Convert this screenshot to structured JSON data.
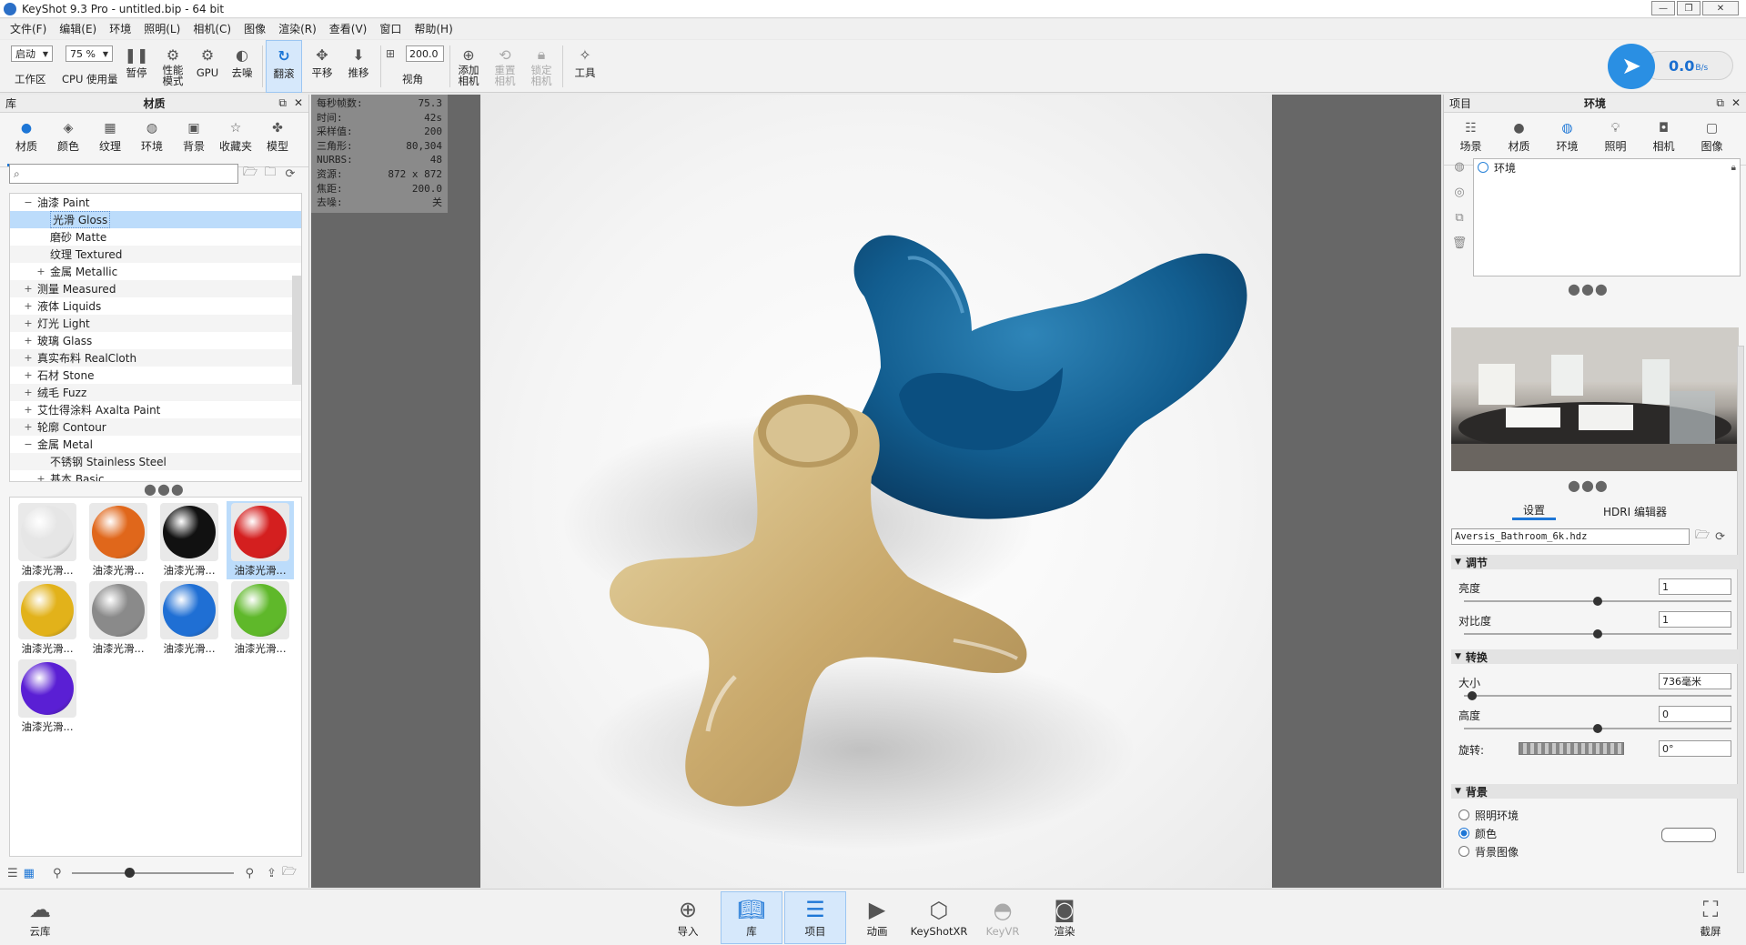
{
  "window": {
    "title": "KeyShot 9.3 Pro  - untitled.bip  - 64 bit",
    "min": "—",
    "max": "❐",
    "close": "✕"
  },
  "menu": [
    "文件(F)",
    "编辑(E)",
    "环境",
    "照明(L)",
    "相机(C)",
    "图像",
    "渲染(R)",
    "查看(V)",
    "窗口",
    "帮助(H)"
  ],
  "toolbar": {
    "workspace_select": "启动",
    "workspace_label": "工作区",
    "cpu_select": "75 %",
    "cpu_label": "CPU 使用量",
    "pause": "暂停",
    "perf_mode": "性能\n模式",
    "gpu": "GPU",
    "denoise": "去噪",
    "tumble": "翻滚",
    "pan": "平移",
    "dolly": "推移",
    "fov_value": "200.0",
    "fov_label": "视角",
    "add_camera": "添加\n相机",
    "reset_camera": "重置\n相机",
    "lock_camera": "锁定\n相机",
    "tools": "工具"
  },
  "throughput": {
    "value": "0.0",
    "unit": "B/s"
  },
  "library": {
    "left_title": "库",
    "title": "材质",
    "tabs": [
      {
        "label": "材质",
        "icon": "material-icon"
      },
      {
        "label": "颜色",
        "icon": "color-icon"
      },
      {
        "label": "纹理",
        "icon": "texture-icon"
      },
      {
        "label": "环境",
        "icon": "environment-icon"
      },
      {
        "label": "背景",
        "icon": "background-icon"
      },
      {
        "label": "收藏夹",
        "icon": "favorites-icon"
      },
      {
        "label": "模型",
        "icon": "model-icon"
      }
    ],
    "tree": [
      {
        "indent": 1,
        "toggle": "−",
        "label": "油漆 Paint"
      },
      {
        "indent": 2,
        "toggle": "",
        "label": "光滑 Gloss",
        "selected": true
      },
      {
        "indent": 2,
        "toggle": "",
        "label": "磨砂 Matte"
      },
      {
        "indent": 2,
        "toggle": "",
        "label": "纹理 Textured"
      },
      {
        "indent": 2,
        "toggle": "+",
        "label": "金属 Metallic"
      },
      {
        "indent": 1,
        "toggle": "+",
        "label": "测量 Measured"
      },
      {
        "indent": 1,
        "toggle": "+",
        "label": "液体 Liquids"
      },
      {
        "indent": 1,
        "toggle": "+",
        "label": "灯光 Light"
      },
      {
        "indent": 1,
        "toggle": "+",
        "label": "玻璃 Glass"
      },
      {
        "indent": 1,
        "toggle": "+",
        "label": "真实布料 RealCloth"
      },
      {
        "indent": 1,
        "toggle": "+",
        "label": "石材 Stone"
      },
      {
        "indent": 1,
        "toggle": "+",
        "label": "绒毛 Fuzz"
      },
      {
        "indent": 1,
        "toggle": "+",
        "label": "艾仕得涂料 Axalta Paint"
      },
      {
        "indent": 1,
        "toggle": "+",
        "label": "轮廓 Contour"
      },
      {
        "indent": 1,
        "toggle": "−",
        "label": "金属 Metal"
      },
      {
        "indent": 2,
        "toggle": "",
        "label": "不锈钢 Stainless Steel"
      },
      {
        "indent": 2,
        "toggle": "+",
        "label": "基本 Basic"
      }
    ],
    "materials": [
      {
        "label": "油漆光滑...",
        "color": "#e6e6e6"
      },
      {
        "label": "油漆光滑...",
        "color": "#e0671b"
      },
      {
        "label": "油漆光滑...",
        "color": "#111111"
      },
      {
        "label": "油漆光滑...",
        "color": "#d41f1f",
        "selected": true
      },
      {
        "label": "油漆光滑...",
        "color": "#e2b21a"
      },
      {
        "label": "油漆光滑...",
        "color": "#8a8a8a"
      },
      {
        "label": "油漆光滑...",
        "color": "#1f6fd4"
      },
      {
        "label": "油漆光滑...",
        "color": "#5fb82a"
      },
      {
        "label": "油漆光滑...",
        "color": "#5a1fd4"
      }
    ]
  },
  "hud": [
    {
      "k": "每秒帧数:",
      "v": "75.3"
    },
    {
      "k": "时间:",
      "v": "42s"
    },
    {
      "k": "采样值:",
      "v": "200"
    },
    {
      "k": "三角形:",
      "v": "80,304"
    },
    {
      "k": "NURBS:",
      "v": "48"
    },
    {
      "k": "资源:",
      "v": "872 x 872"
    },
    {
      "k": "焦距:",
      "v": "200.0"
    },
    {
      "k": "去噪:",
      "v": "关"
    }
  ],
  "project": {
    "left_title": "项目",
    "title": "环境",
    "tabs": [
      {
        "label": "场景",
        "icon": "scene-icon"
      },
      {
        "label": "材质",
        "icon": "material-icon"
      },
      {
        "label": "环境",
        "icon": "environment-icon"
      },
      {
        "label": "照明",
        "icon": "lighting-icon"
      },
      {
        "label": "相机",
        "icon": "camera-icon"
      },
      {
        "label": "图像",
        "icon": "image-icon"
      }
    ],
    "env_item": "环境",
    "sub_tabs": [
      "设置",
      "HDRI 编辑器"
    ],
    "hdri_file": "Aversis_Bathroom_6k.hdz",
    "sections": {
      "adjust": "调节",
      "transform": "转换",
      "background": "背景"
    },
    "props": {
      "brightness": {
        "label": "亮度",
        "value": "1",
        "level": 0.5
      },
      "contrast": {
        "label": "对比度",
        "value": "1",
        "level": 0.5
      },
      "size": {
        "label": "大小",
        "value": "736毫米",
        "level": 0.03
      },
      "height": {
        "label": "高度",
        "value": "0",
        "level": 0.5
      },
      "rotation": {
        "label": "旋转:",
        "value": "0°"
      }
    },
    "bg_options": [
      {
        "label": "照明环境",
        "on": false
      },
      {
        "label": "颜色",
        "on": true
      },
      {
        "label": "背景图像",
        "on": false
      }
    ]
  },
  "bottom": {
    "cloud": "云库",
    "import": "导入",
    "library": "库",
    "project": "项目",
    "animation": "动画",
    "keyshotxr": "KeyShotXR",
    "keyvr": "KeyVR",
    "render": "渲染",
    "screenshot": "截屏"
  }
}
